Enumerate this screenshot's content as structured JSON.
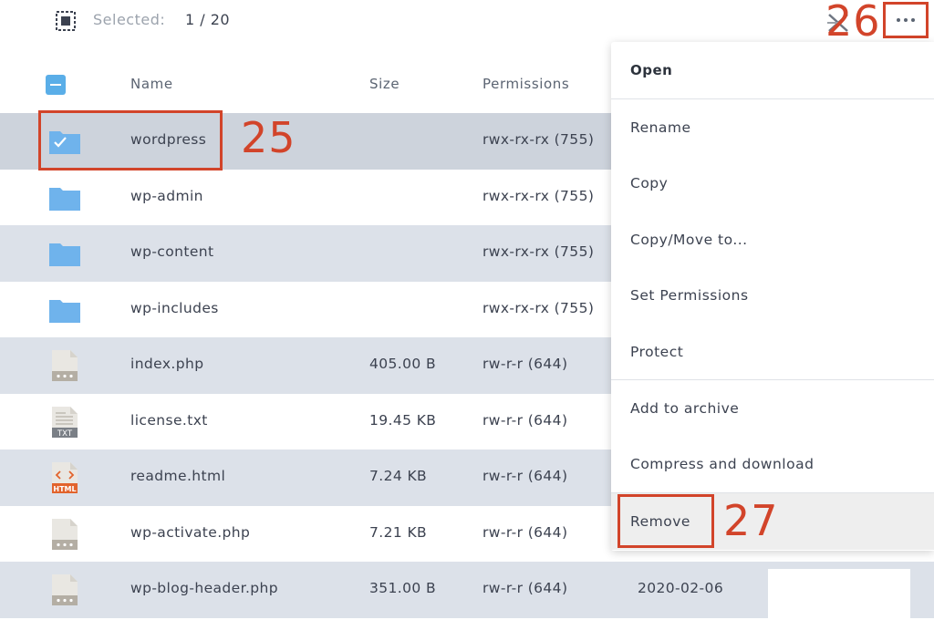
{
  "topbar": {
    "selected_label": "Selected:",
    "selected_count": "1 / 20"
  },
  "table": {
    "headers": {
      "name": "Name",
      "size": "Size",
      "permissions": "Permissions"
    },
    "rows": [
      {
        "name": "wordpress",
        "size": "",
        "permissions": "rwx-rx-rx (755)",
        "date": "",
        "icon": "folder-checked-icon",
        "selected": true
      },
      {
        "name": "wp-admin",
        "size": "",
        "permissions": "rwx-rx-rx (755)",
        "date": "",
        "icon": "folder-icon"
      },
      {
        "name": "wp-content",
        "size": "",
        "permissions": "rwx-rx-rx (755)",
        "date": "",
        "icon": "folder-icon"
      },
      {
        "name": "wp-includes",
        "size": "",
        "permissions": "rwx-rx-rx (755)",
        "date": "",
        "icon": "folder-icon"
      },
      {
        "name": "index.php",
        "size": "405.00 B",
        "permissions": "rw-r-r (644)",
        "date": "",
        "icon": "php-file-icon"
      },
      {
        "name": "license.txt",
        "size": "19.45 KB",
        "permissions": "rw-r-r (644)",
        "date": "",
        "icon": "txt-file-icon",
        "icon_badge": "TXT"
      },
      {
        "name": "readme.html",
        "size": "7.24 KB",
        "permissions": "rw-r-r (644)",
        "date": "",
        "icon": "html-file-icon",
        "icon_badge": "HTML"
      },
      {
        "name": "wp-activate.php",
        "size": "7.21 KB",
        "permissions": "rw-r-r (644)",
        "date": "",
        "icon": "php-file-icon"
      },
      {
        "name": "wp-blog-header.php",
        "size": "351.00 B",
        "permissions": "rw-r-r (644)",
        "date": "2020-02-06",
        "icon": "php-file-icon"
      }
    ]
  },
  "context_menu": {
    "items": [
      {
        "label": "Open"
      },
      {
        "label": "Rename"
      },
      {
        "label": "Copy"
      },
      {
        "label": "Copy/Move to..."
      },
      {
        "label": "Set Permissions"
      },
      {
        "label": "Protect"
      },
      {
        "label": "Add to archive"
      },
      {
        "label": "Compress and download"
      },
      {
        "label": "Remove"
      }
    ]
  },
  "annotations": {
    "n25": "25",
    "n26": "26",
    "n27": "27"
  },
  "colors": {
    "annotation": "#d2442a",
    "folder": "#6fb3ec",
    "checkbox": "#5aaee8",
    "row_shade": "#dce1e9",
    "html_badge": "#e2632c",
    "txt_badge": "#7a7f86"
  }
}
